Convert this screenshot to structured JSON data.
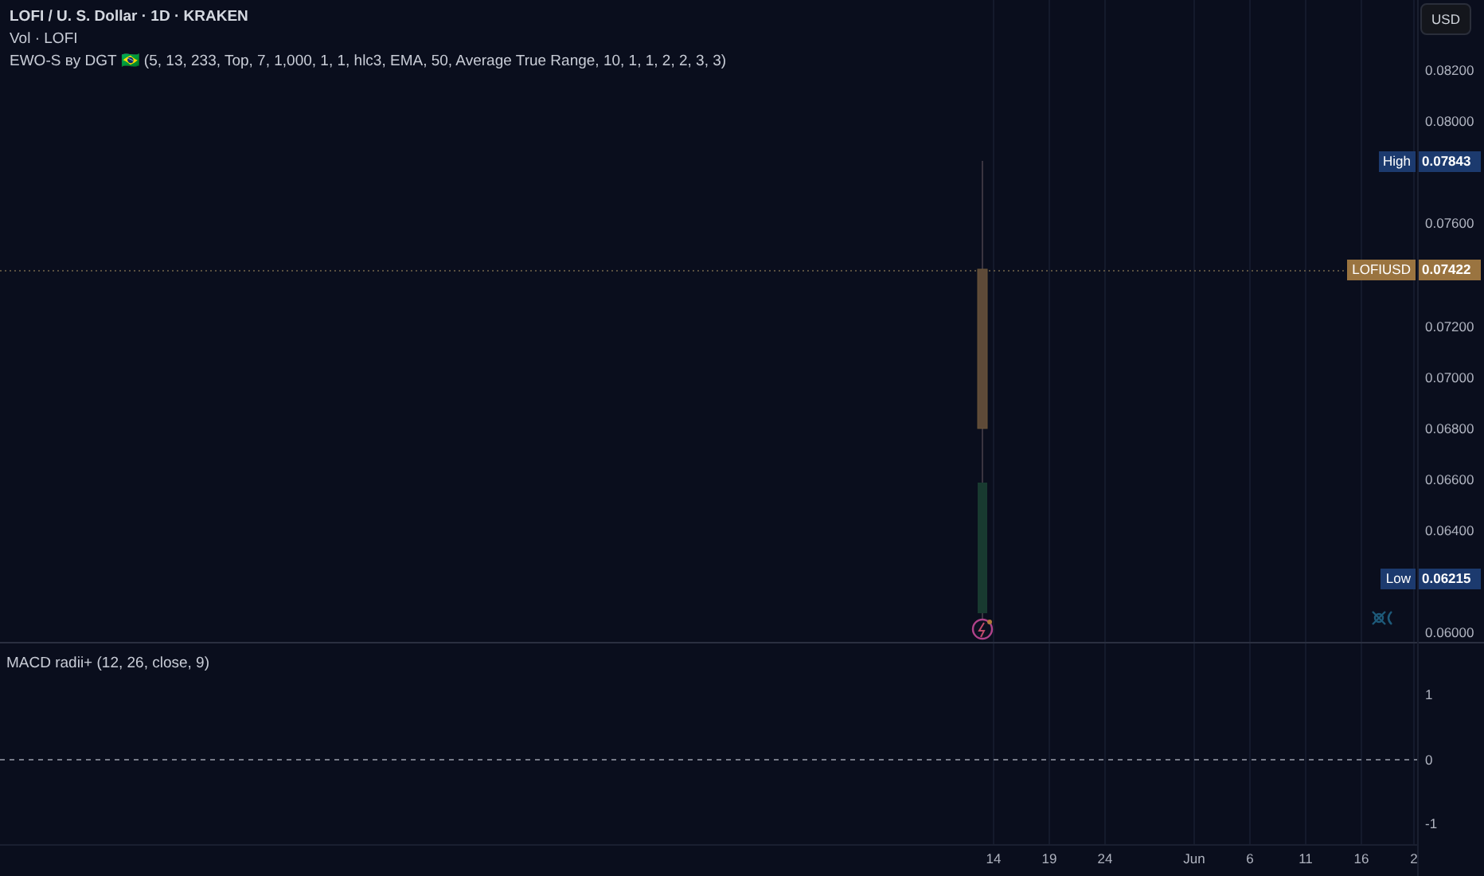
{
  "legend": [
    {
      "text": "LOFI / U. S. Dollar · 1D · KRAKEN",
      "kind": "title"
    },
    {
      "text": "Vol · LOFI",
      "kind": "study"
    },
    {
      "text": "EWO-S вy DGT 🇧🇷 (5, 13, 233, Top, 7, 1,000, 1, 1, hlc3, EMA, 50, Average True Range, 10, 1, 1, 2, 2, 3, 3)",
      "kind": "study"
    }
  ],
  "currency_button": "USD",
  "price_ticks": [
    "0.08200",
    "0.08000",
    "0.07600",
    "0.07200",
    "0.07000",
    "0.06800",
    "0.06600",
    "0.06400",
    "0.06000"
  ],
  "price_labels": [
    {
      "name": "High",
      "value": "0.07843",
      "color": "#1c3a6e"
    },
    {
      "name": "LOFIUSD",
      "value": "0.07422",
      "color": "#9a7440"
    },
    {
      "name": "Low",
      "value": "0.06215",
      "color": "#1c3a6e"
    }
  ],
  "macd": {
    "legend": "MACD radii+ (12, 26, close, 9)",
    "ticks": [
      "1",
      "0",
      "-1"
    ]
  },
  "time_ticks": [
    "14",
    "19",
    "24",
    "Jun",
    "6",
    "11",
    "16",
    "2"
  ]
}
